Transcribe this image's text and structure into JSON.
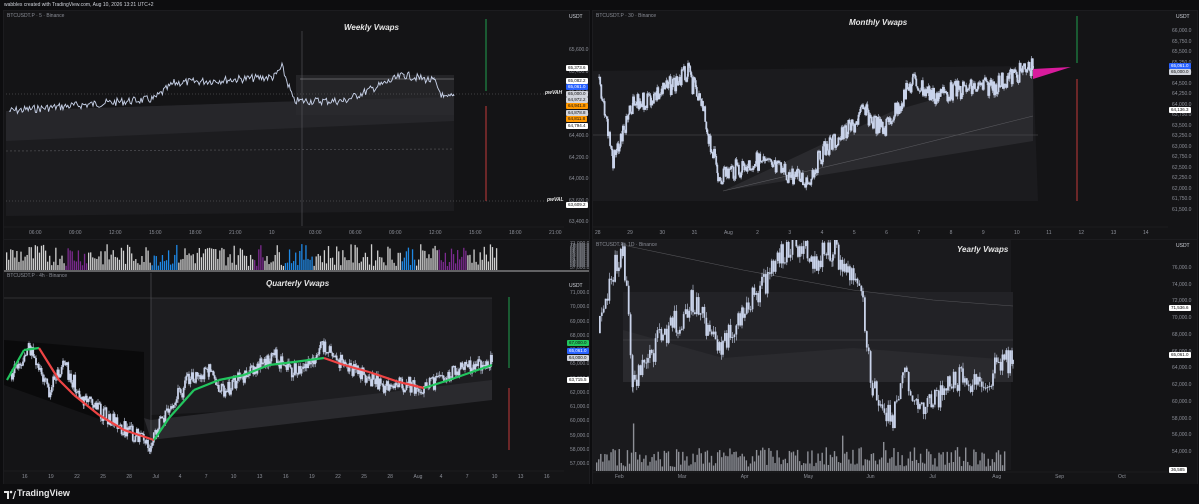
{
  "header": {
    "caption": "wabbles created with TradingView.com, Aug 10, 2026 13:21 UTC+2"
  },
  "branding": {
    "name": "TradingView"
  },
  "panels": {
    "weekly": {
      "symbol": "BTCUSDT.P · 5 · Binance",
      "title": "Weekly Vwaps",
      "unit": "USDT",
      "price_labels": [
        "65,600.0",
        "65,400.0",
        "65,200.0",
        "64,800.0",
        "64,400.0",
        "64,200.0",
        "64,000.0",
        "63,600.0",
        "63,400.0"
      ],
      "time_labels": [
        "06:00",
        "09:00",
        "12:00",
        "15:00",
        "18:00",
        "21:00",
        "10",
        "03:00",
        "06:00",
        "09:00",
        "12:00",
        "15:00",
        "18:00",
        "21:00"
      ],
      "tags": [
        {
          "text": "65,373.6",
          "bg": "#ffffff",
          "fg": "#111111"
        },
        {
          "text": "65,082.2",
          "bg": "#ffffff",
          "fg": "#111111"
        },
        {
          "text": "65,061.0",
          "bg": "#2962ff",
          "fg": "#ffffff"
        },
        {
          "text": "65,000.0",
          "bg": "#d1d4dc",
          "fg": "#111111"
        },
        {
          "text": "64,972.2",
          "bg": "#d1d4dc",
          "fg": "#111111"
        },
        {
          "text": "64,941.8",
          "bg": "#ff9800",
          "fg": "#111111"
        },
        {
          "text": "64,878.8",
          "bg": "#d1d4dc",
          "fg": "#111111"
        },
        {
          "text": "64,811.8",
          "bg": "#ff9800",
          "fg": "#111111"
        },
        {
          "text": "64,794.4",
          "bg": "#ffffff",
          "fg": "#111111"
        },
        {
          "text": "63,609.2",
          "bg": "#ffffff",
          "fg": "#111111"
        }
      ],
      "level_labels": {
        "vah": "pwVAH",
        "val": "pwVAL"
      }
    },
    "monthly": {
      "symbol": "BTCUSDT.P · 30 · Binance",
      "title": "Monthly Vwaps",
      "unit": "USDT",
      "price_labels": [
        "66,000.0",
        "65,750.0",
        "65,500.0",
        "65,250.0",
        "64,750.0",
        "64,500.0",
        "64,250.0",
        "64,000.0",
        "63,750.0",
        "63,500.0",
        "63,250.0",
        "63,000.0",
        "62,750.0",
        "62,500.0",
        "62,250.0",
        "62,000.0",
        "61,750.0",
        "61,500.0"
      ],
      "time_labels": [
        "28",
        "29",
        "30",
        "31",
        "Aug",
        "2",
        "3",
        "4",
        "5",
        "6",
        "7",
        "8",
        "9",
        "10",
        "11",
        "12",
        "13",
        "14"
      ],
      "tags": [
        {
          "text": "65,061.0",
          "bg": "#2962ff",
          "fg": "#ffffff"
        },
        {
          "text": "65,000.0",
          "bg": "#d1d4dc",
          "fg": "#111111"
        },
        {
          "text": "64,136.3",
          "bg": "#ffffff",
          "fg": "#111111"
        }
      ]
    },
    "quarterly": {
      "symbol": "BTCUSDT.P · 4h · Binance",
      "title": "Quarterly Vwaps",
      "unit": "USDT",
      "price_labels": [
        "71,000.0",
        "70,000.0",
        "69,000.0",
        "68,000.0",
        "66,000.0",
        "65,000.0",
        "63,000.0",
        "62,000.0",
        "61,000.0",
        "60,000.0",
        "59,000.0",
        "58,000.0",
        "57,000.0"
      ],
      "time_labels": [
        "16",
        "19",
        "22",
        "25",
        "28",
        "Jul",
        "4",
        "7",
        "10",
        "13",
        "16",
        "19",
        "22",
        "25",
        "28",
        "Aug",
        "4",
        "7",
        "10",
        "13",
        "16"
      ],
      "tags": [
        {
          "text": "67,000.0",
          "bg": "#22c55e",
          "fg": "#111111"
        },
        {
          "text": "65,061.0",
          "bg": "#2962ff",
          "fg": "#ffffff"
        },
        {
          "text": "64,000.0",
          "bg": "#d1d4dc",
          "fg": "#111111"
        },
        {
          "text": "63,715.5",
          "bg": "#ffffff",
          "fg": "#111111"
        }
      ],
      "osc_labels": [
        "100.0",
        "50.0",
        "0.0"
      ]
    },
    "yearly": {
      "symbol": "BTCUSDT.P · 1D · Binance",
      "title": "Yearly Vwaps",
      "unit": "USDT",
      "price_labels": [
        "76,000.0",
        "74,000.0",
        "72,000.0",
        "70,000.0",
        "68,000.0",
        "66,000.0",
        "64,000.0",
        "62,000.0",
        "60,000.0",
        "58,000.0",
        "56,000.0",
        "54,000.0"
      ],
      "time_labels": [
        "Feb",
        "Mar",
        "Apr",
        "May",
        "Jun",
        "Jul",
        "Aug",
        "Sep",
        "Oct"
      ],
      "tags": [
        {
          "text": "71,536.6",
          "bg": "#ffffff",
          "fg": "#111111"
        },
        {
          "text": "65,061.0",
          "bg": "#ffffff",
          "fg": "#111111"
        },
        {
          "text": "36,585",
          "bg": "#ffffff",
          "fg": "#111111"
        }
      ]
    }
  },
  "colors": {
    "up": "#22c55e",
    "down": "#ef4444",
    "candle": "#c9d3ea",
    "magenta": "#d81b9c",
    "band": "#2a2a2e"
  }
}
